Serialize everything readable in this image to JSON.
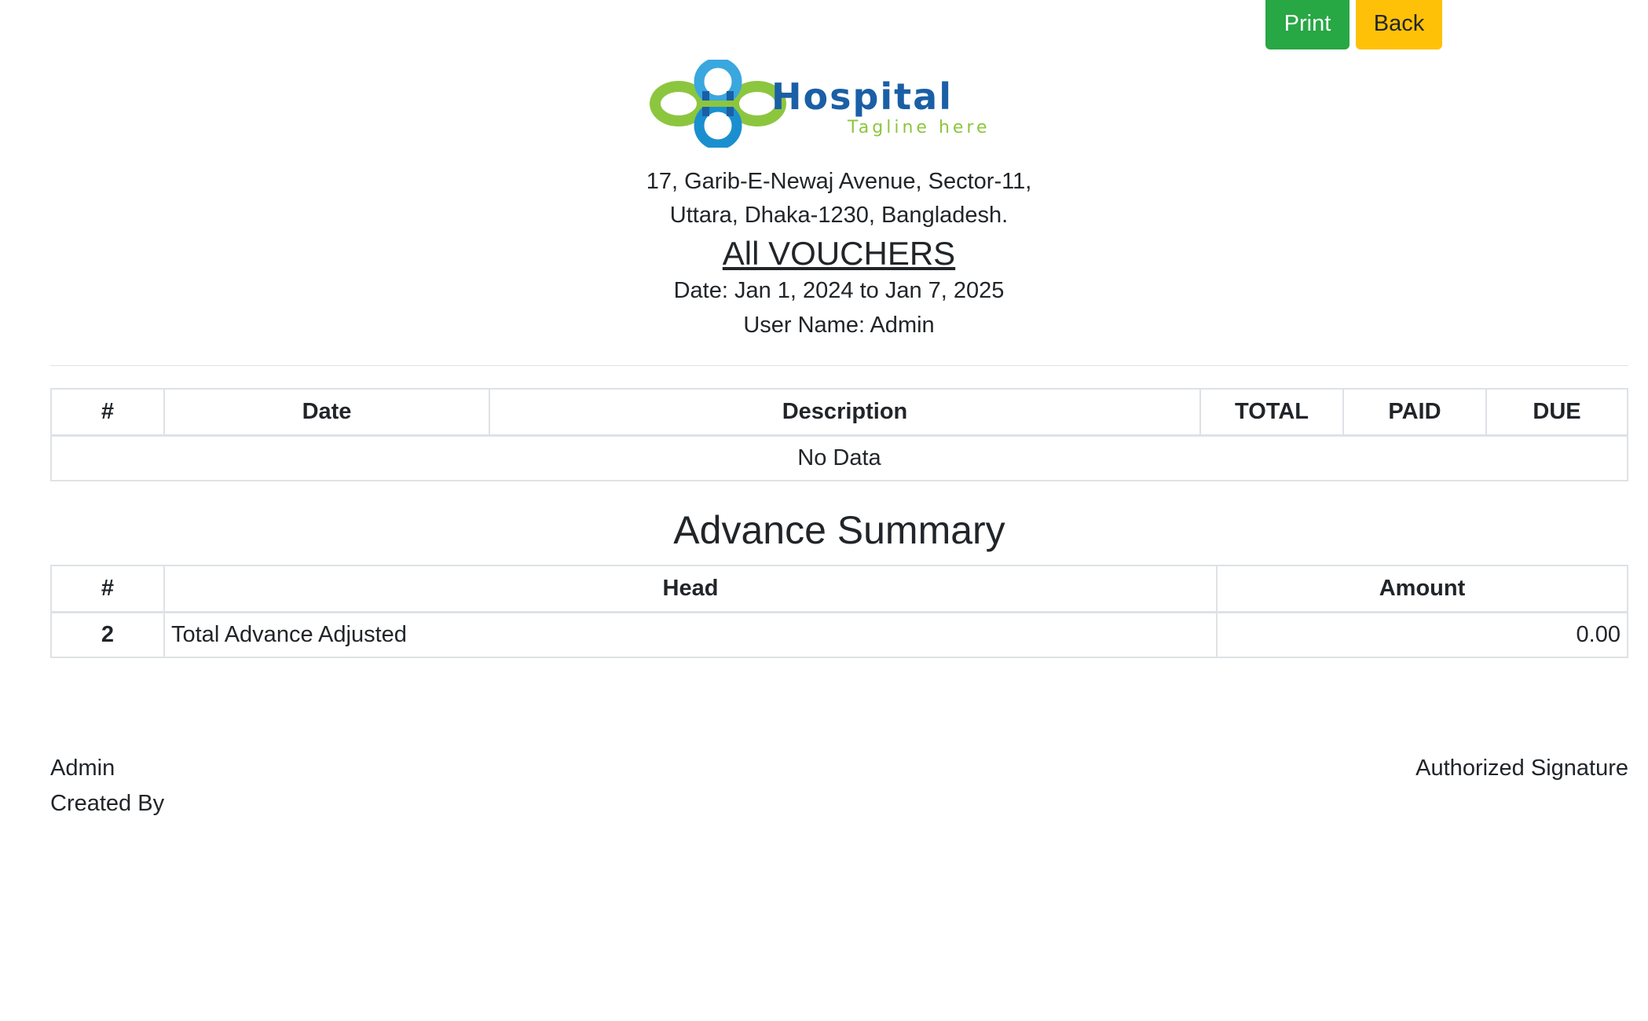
{
  "actions": {
    "print_label": "Print",
    "back_label": "Back"
  },
  "brand": {
    "name": "Hospital",
    "tagline": "Tagline here",
    "colors": {
      "primary_blue": "#1a5fa6",
      "light_blue": "#3aa7de",
      "green": "#8cc63f"
    }
  },
  "address": {
    "line1": "17, Garib-E-Newaj Avenue, Sector-11,",
    "line2": "Uttara, Dhaka-1230, Bangladesh."
  },
  "report": {
    "title": "All VOUCHERS",
    "date_range": "Date: Jan 1, 2024 to Jan 7, 2025",
    "user": "User Name: Admin"
  },
  "voucher_table": {
    "headers": [
      "#",
      "Date",
      "Description",
      "TOTAL",
      "PAID",
      "DUE"
    ],
    "empty_message": "No Data"
  },
  "advance_summary": {
    "title": "Advance Summary",
    "headers": [
      "#",
      "Head",
      "Amount"
    ],
    "rows": [
      {
        "index": "2",
        "head": "Total Advance Adjusted",
        "amount": "0.00"
      }
    ]
  },
  "footer": {
    "created_name": "Admin",
    "created_label": "Created By",
    "signature_label": "Authorized Signature"
  }
}
